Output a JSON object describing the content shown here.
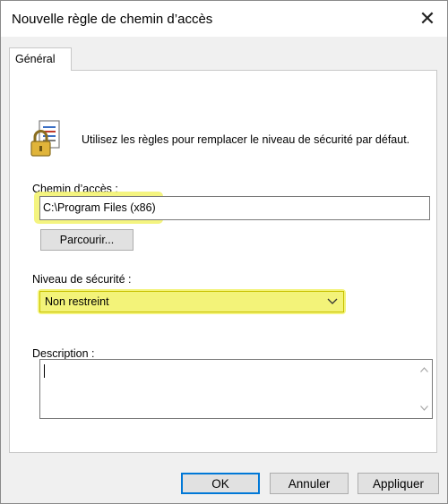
{
  "window": {
    "title": "Nouvelle règle de chemin d’accès",
    "close_glyph": "✕"
  },
  "tabs": [
    {
      "label": "Général"
    }
  ],
  "intro": {
    "text": "Utilisez les règles pour remplacer le niveau de sécurité par défaut.",
    "icon": "lock-document-icon"
  },
  "path": {
    "label": "Chemin d’accès :",
    "value": "C:\\Program Files (x86)",
    "browse_label": "Parcourir..."
  },
  "security": {
    "label": "Niveau de sécurité :",
    "selected": "Non restreint"
  },
  "description": {
    "label": "Description :",
    "value": ""
  },
  "buttons": {
    "ok": "OK",
    "cancel": "Annuler",
    "apply": "Appliquer"
  },
  "colors": {
    "highlight": "#f2f26a",
    "focus_border": "#0078d7",
    "panel_bg": "#f0f0f0"
  }
}
